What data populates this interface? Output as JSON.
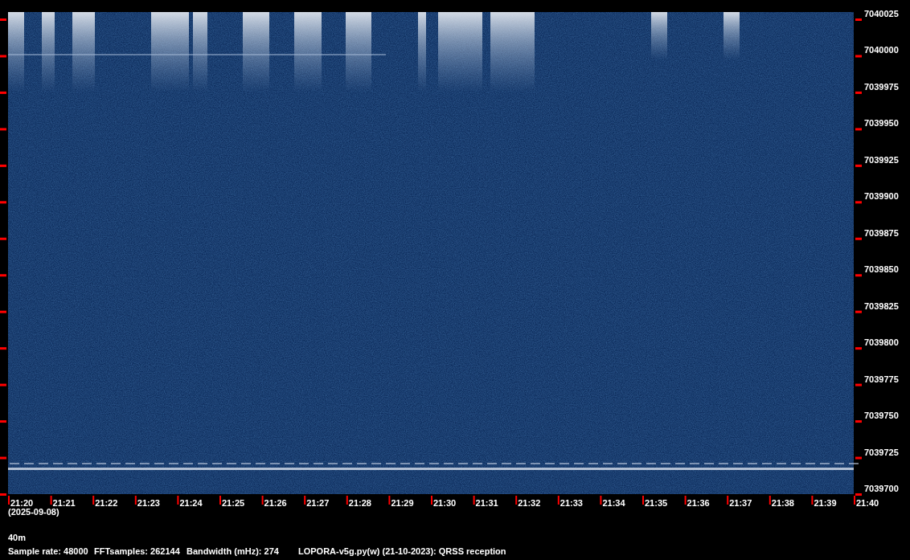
{
  "frequency_axis": {
    "labels": [
      "7040025",
      "7040000",
      "7039975",
      "7039950",
      "7039925",
      "7039900",
      "7039875",
      "7039850",
      "7039825",
      "7039800",
      "7039775",
      "7039750",
      "7039725",
      "7039700"
    ]
  },
  "time_axis": {
    "labels": [
      "21:20",
      "21:21",
      "21:22",
      "21:23",
      "21:24",
      "21:25",
      "21:26",
      "21:27",
      "21:28",
      "21:29",
      "21:30",
      "21:31",
      "21:32",
      "21:33",
      "21:34",
      "21:35",
      "21:36",
      "21:37",
      "21:38",
      "21:39",
      "21:40"
    ],
    "date": "(2025-09-08)"
  },
  "band": "40m",
  "footer": [
    "Sample rate: 48000",
    "FFTsamples: 262144",
    "Bandwidth (mHz): 274",
    "LOPORA-v5g.py(w) (21-10-2023): QRSS reception"
  ]
}
